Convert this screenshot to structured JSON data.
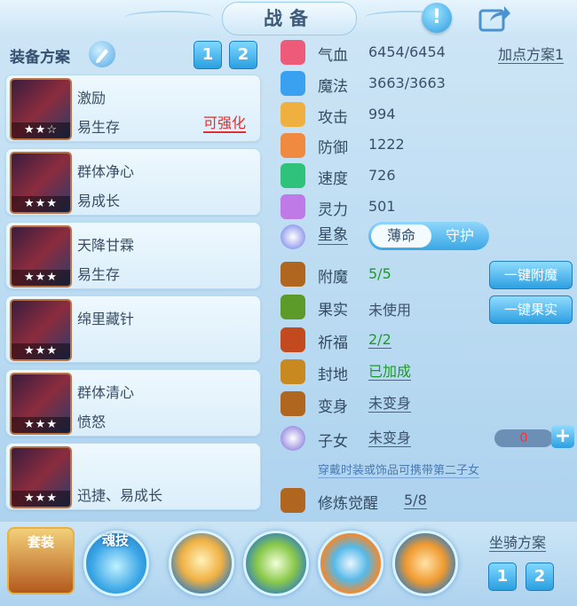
{
  "header": {
    "title": "战备",
    "info_icon": "question-icon",
    "share_icon": "share-icon"
  },
  "equip_plan": {
    "label": "装备方案",
    "buttons": [
      "1",
      "2"
    ]
  },
  "cards": [
    {
      "name": "激励",
      "trait": "易生存",
      "stars": "★★☆",
      "upgrade": "可强化"
    },
    {
      "name": "群体净心",
      "trait": "易成长",
      "stars": "★★★",
      "upgrade": ""
    },
    {
      "name": "天降甘霖",
      "trait": "易生存",
      "stars": "★★★",
      "upgrade": ""
    },
    {
      "name": "绵里藏针",
      "trait": "",
      "stars": "★★★",
      "upgrade": ""
    },
    {
      "name": "群体清心",
      "trait": "愤怒",
      "stars": "★★★",
      "upgrade": ""
    },
    {
      "name": "",
      "trait": "迅捷、易成长",
      "stars": "★★★",
      "upgrade": ""
    }
  ],
  "stats": [
    {
      "label": "气血",
      "value": "6454/6454",
      "color": "#ee5a7a"
    },
    {
      "label": "魔法",
      "value": "3663/3663",
      "color": "#3aa0f0"
    },
    {
      "label": "攻击",
      "value": "994",
      "color": "#f0b040"
    },
    {
      "label": "防御",
      "value": "1222",
      "color": "#f08a40"
    },
    {
      "label": "速度",
      "value": "726",
      "color": "#2ec27a"
    },
    {
      "label": "灵力",
      "value": "501",
      "color": "#c07ae8"
    }
  ],
  "add_point_plan": "加点方案1",
  "xingxiang": {
    "label": "星象",
    "options": [
      "薄命",
      "守护"
    ]
  },
  "enhance": [
    {
      "label": "附魔",
      "value": "5/5"
    },
    {
      "label": "果实",
      "value": "未使用"
    },
    {
      "label": "祈福",
      "value": "2/2"
    },
    {
      "label": "封地",
      "value": "已加成"
    },
    {
      "label": "变身",
      "value": "未变身"
    },
    {
      "label": "子女",
      "value": "未变身"
    }
  ],
  "buttons": {
    "enchant": "一键附魔",
    "fruit": "一键果实"
  },
  "child_count": "0",
  "note": "穿戴时装或饰品可携带第二子女",
  "cultivate": {
    "label": "修炼觉醒",
    "value": "5/8"
  },
  "bottom": {
    "suit": "套装",
    "soul": "魂技",
    "mount_plan": "坐骑方案",
    "mount_buttons": [
      "1",
      "2"
    ]
  }
}
